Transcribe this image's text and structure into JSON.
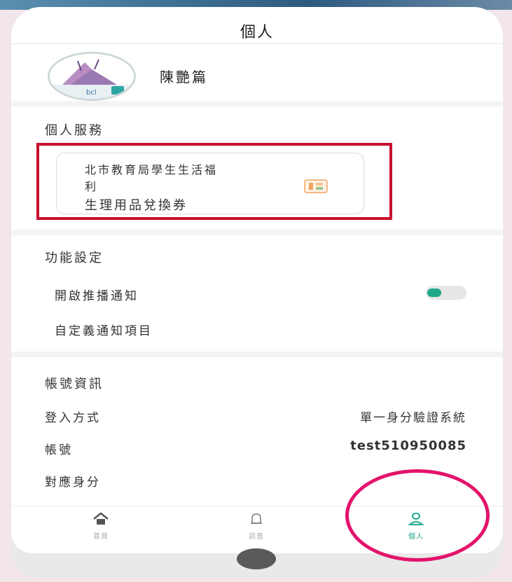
{
  "header": {
    "title": "個人"
  },
  "profile": {
    "name": "陳艷篇"
  },
  "personal_service": {
    "section_title": "個人服務",
    "card": {
      "line1": "北市教育局學生生活福",
      "line2": "利",
      "line3": "生理用品兌換券",
      "icon": "coupon-icon"
    }
  },
  "function_settings": {
    "section_title": "功能設定",
    "push_label": "開啟推播通知",
    "push_enabled": true,
    "custom_label": "自定義通知項目"
  },
  "account": {
    "section_title": "帳號資訊",
    "login_method_label": "登入方式",
    "login_method_value": "單一身分驗證系統",
    "account_label": "帳號",
    "account_value": "test510950085",
    "identity_label": "對應身分",
    "identity_value": ""
  },
  "nav": {
    "items": [
      {
        "label": "首頁",
        "icon": "home-icon"
      },
      {
        "label": "訊息",
        "icon": "bell-icon"
      },
      {
        "label": "個人",
        "icon": "person-icon"
      }
    ],
    "active_index": 2
  },
  "colors": {
    "accent": "#1faa8a",
    "highlight_box": "#c8102e",
    "circle_annotation": "#e3136b"
  }
}
